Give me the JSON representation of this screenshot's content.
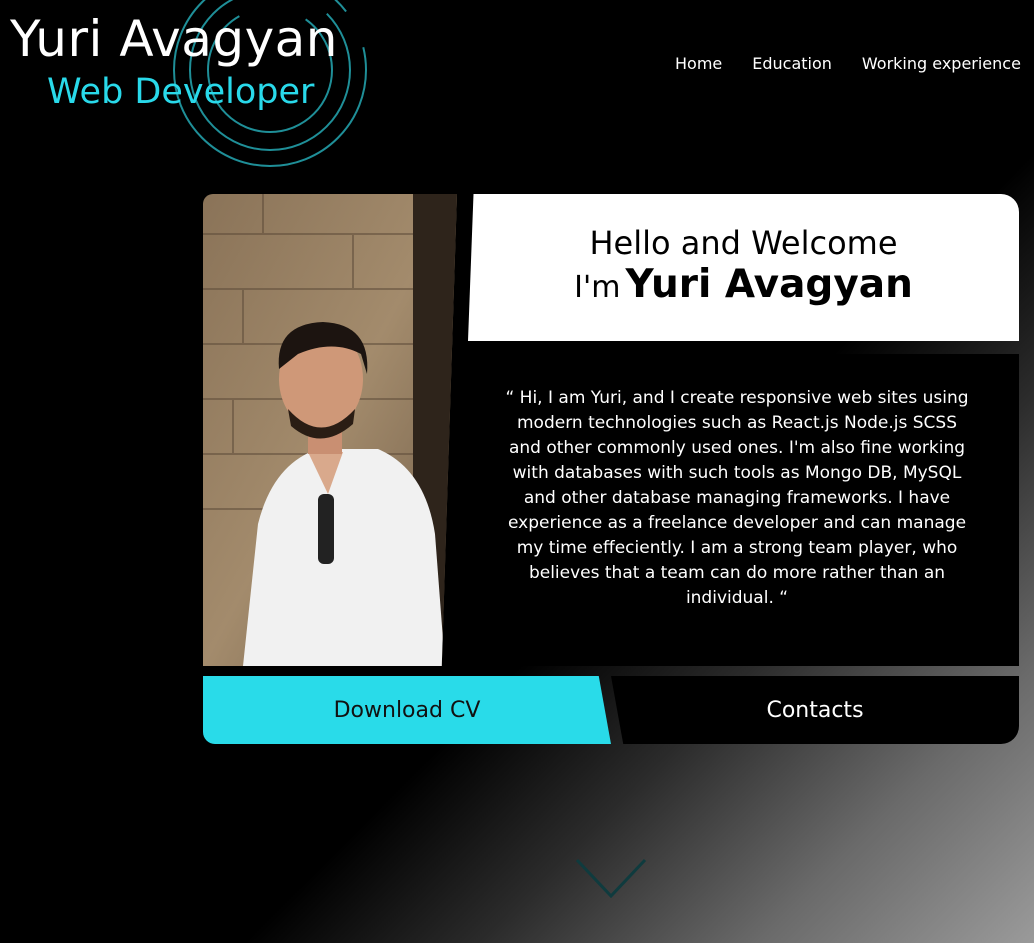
{
  "header": {
    "name": "Yuri Avagyan",
    "role": "Web Developer",
    "nav": [
      "Home",
      "Education",
      "Working experience"
    ]
  },
  "hero": {
    "greeting": "Hello and Welcome",
    "iam": "I'm",
    "name": "Yuri Avagyan",
    "bio": "“ Hi, I am Yuri, and I create responsive web sites using modern technologies such as React.js Node.js SCSS and other commonly used ones. I'm also fine working with databases with such tools as Mongo DB, MySQL and other database managing frameworks. I have experience as a freelance developer and can manage my time effeciently. I am a strong team player, who believes that a team can do more rather than an individual. “",
    "download_cv": "Download CV",
    "contacts": "Contacts"
  },
  "colors": {
    "accent": "#29dbe9",
    "text": "#ffffff",
    "background": "#000000"
  },
  "icons": {
    "scroll_down": "chevron-down-icon",
    "logo_rings": "circle-rings-icon"
  }
}
